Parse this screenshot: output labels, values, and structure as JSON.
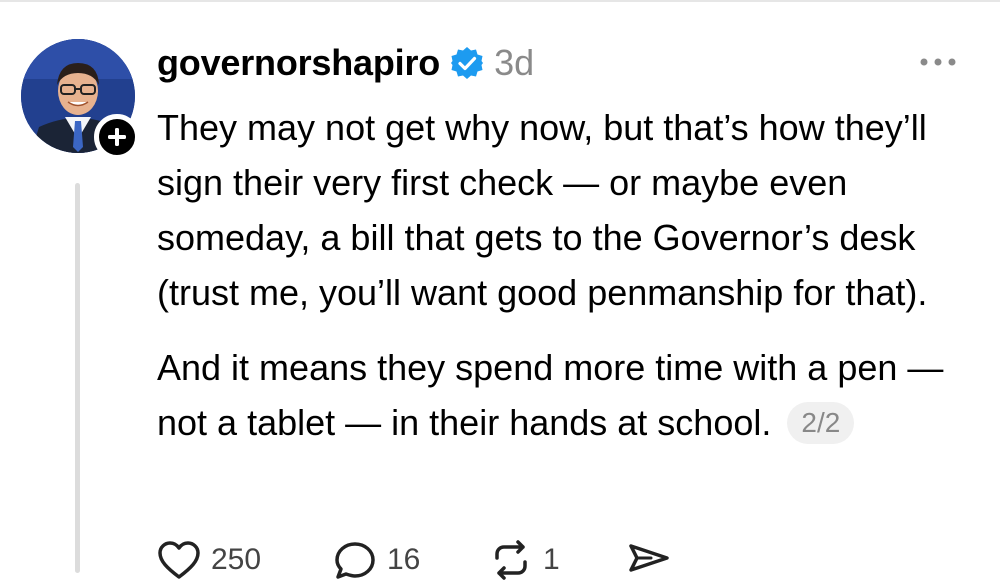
{
  "post": {
    "username": "governorshapiro",
    "verified": true,
    "timestamp": "3d",
    "paragraphs": [
      "They may not get why now, but that’s how they’ll sign their very first check — or maybe even someday, a bill that gets to the Governor’s desk (trust me, you’ll want good penmanship for that).",
      "And it means they spend more time with a pen — not a tablet — in their hands at school."
    ],
    "page_indicator": "2/2"
  },
  "actions": {
    "likes": "250",
    "replies": "16",
    "reposts": "1"
  },
  "icons": {
    "verified": "verified-badge-icon",
    "follow": "plus-icon",
    "more": "more-options-icon",
    "like": "heart-icon",
    "reply": "comment-icon",
    "repost": "repost-icon",
    "share": "send-icon"
  },
  "colors": {
    "verified_blue": "#1d9bf0",
    "timestamp_gray": "#8a8a8a",
    "thread_line": "#dcdcdc"
  }
}
